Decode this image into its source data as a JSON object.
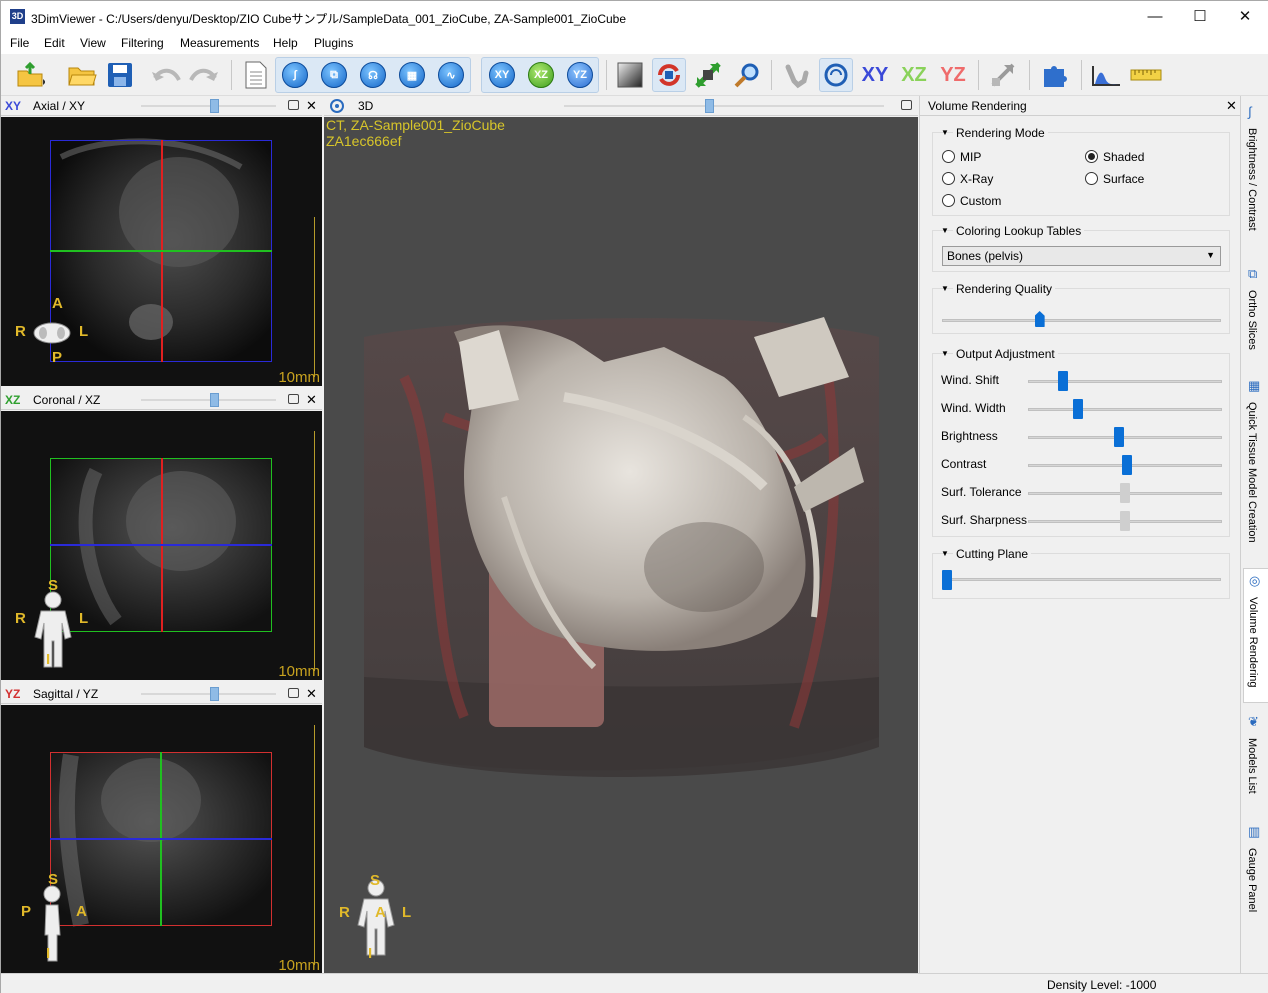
{
  "window": {
    "app_icon": "3D",
    "title": "3DimViewer - C:/Users/denyu/Desktop/ZIO Cubeサンプル/SampleData_001_ZioCube, ZA-Sample001_ZioCube",
    "minimize": "—",
    "maximize": "☐",
    "close": "✕"
  },
  "menu": [
    "File",
    "Edit",
    "View",
    "Filtering",
    "Measurements",
    "Help",
    "Plugins"
  ],
  "toolbar": {
    "icons": [
      "open-dicom-icon",
      "open-folder-icon",
      "save-icon",
      "undo-icon",
      "redo-icon",
      "new-document-icon",
      "brightness-contrast-icon",
      "ortho-slices-icon",
      "tissue-model-icon",
      "checker-icon",
      "density-window-icon",
      "xy-view-icon",
      "xz-view-icon",
      "yz-view-icon",
      "gradient-icon",
      "rotate-scene-icon",
      "pan-icon",
      "zoom-icon",
      "bone-select-icon",
      "volume-rendering-icon",
      "xy-slice-icon",
      "xz-slice-icon",
      "yz-slice-icon",
      "arrow-tool-icon",
      "plugin-puzzle-icon",
      "histogram-icon",
      "ruler-icon"
    ],
    "xy": "XY",
    "xz": "XZ",
    "yz": "YZ"
  },
  "panels": {
    "axial": {
      "tag": "XY",
      "name": "Axial / XY",
      "scale": "10mm",
      "o_top": "A",
      "o_left": "R",
      "o_right": "L",
      "o_bottom": "P"
    },
    "coronal": {
      "tag": "XZ",
      "name": "Coronal / XZ",
      "scale": "10mm",
      "o_top": "S",
      "o_left": "R",
      "o_right": "L",
      "o_bottom": "I"
    },
    "sagittal": {
      "tag": "YZ",
      "name": "Sagittal / YZ",
      "scale": "10mm",
      "o_top": "S",
      "o_left": "P",
      "o_right": "A",
      "o_bottom": "I"
    },
    "view3d": {
      "name": "3D",
      "info1": "CT, ZA-Sample001_ZioCube",
      "info2": "ZA1ec666ef",
      "o_top": "S",
      "o_left": "R",
      "o_center": "A",
      "o_right": "L",
      "o_bottom": "I"
    }
  },
  "volume_rendering": {
    "title": "Volume Rendering",
    "close": "✕",
    "rendering_mode": {
      "title": "Rendering Mode",
      "options": [
        {
          "label": "MIP",
          "selected": false
        },
        {
          "label": "Shaded",
          "selected": true
        },
        {
          "label": "X-Ray",
          "selected": false
        },
        {
          "label": "Surface",
          "selected": false
        },
        {
          "label": "Custom",
          "selected": false
        }
      ]
    },
    "coloring": {
      "title": "Coloring Lookup Tables",
      "selected": "Bones (pelvis)"
    },
    "quality": {
      "title": "Rendering Quality",
      "value": 0.35
    },
    "output": {
      "title": "Output Adjustment",
      "sliders": [
        {
          "label": "Wind. Shift",
          "value": 0.18,
          "enabled": true
        },
        {
          "label": "Wind. Width",
          "value": 0.26,
          "enabled": true
        },
        {
          "label": "Brightness",
          "value": 0.47,
          "enabled": true
        },
        {
          "label": "Contrast",
          "value": 0.51,
          "enabled": true
        },
        {
          "label": "Surf. Tolerance",
          "value": 0.5,
          "enabled": false
        },
        {
          "label": "Surf. Sharpness",
          "value": 0.5,
          "enabled": false
        }
      ]
    },
    "cutting": {
      "title": "Cutting Plane",
      "value": 0.0
    }
  },
  "right_tabs": [
    "Brightness / Contrast",
    "Ortho Slices",
    "Quick Tissue Model Creation",
    "Volume Rendering",
    "Models List",
    "Gauge Panel"
  ],
  "status": {
    "density": "Density Level: -1000"
  },
  "colors": {
    "xy": "#3a49d8",
    "xz": "#2fa02f",
    "yz": "#d23030",
    "accent": "#0a6fd6",
    "orient": "#e1b92a"
  }
}
